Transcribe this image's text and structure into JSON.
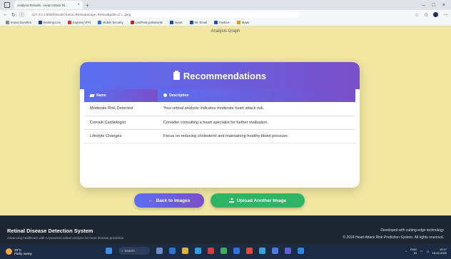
{
  "browser": {
    "tab_title": "Analysis Results - Heart Attack Ri...",
    "url": "127.0.0.1:5000/results?name=Retina&image=Retinal&path=C:\\...jpeg",
    "bookmarks": [
      "Import favorites",
      "Booking.com",
      "Express VPN",
      "Mobile Security",
      "LastPass passwords",
      "News",
      "Mr. Email",
      "Fashion",
      "Maps"
    ]
  },
  "page": {
    "graph_label": "Analysis Graph",
    "card_title": "Recommendations",
    "table": {
      "headers": [
        "Name",
        "Description"
      ],
      "rows": [
        [
          "Moderate Risk Detected",
          "Your retinal analysis indicates moderate heart attack risk."
        ],
        [
          "Consult Cardiologist",
          "Consider consulting a heart specialist for further evaluation."
        ],
        [
          "Lifestyle Changes",
          "Focus on reducing cholesterol and maintaining healthy blood pressure."
        ]
      ]
    },
    "back_button": "Back to Images",
    "upload_button": "Upload Another Image"
  },
  "footer": {
    "title": "Retinal Disease Detection System",
    "subtitle": "Advancing healthcare with AI-powered retinal analysis for heart disease prediction",
    "tagline": "Developed with cutting-edge technology",
    "copyright": "© 2024 Heart Attack Risk Prediction System. All rights reserved."
  },
  "taskbar": {
    "weather_temp": "28°C",
    "weather_desc": "Partly sunny",
    "search_label": "Search",
    "lang": "ENG",
    "lang_sub": "IN",
    "time": "10:17",
    "date": "16-02-2025"
  },
  "colors": {
    "primary_gradient_start": "#5a6ff0",
    "primary_gradient_end": "#7a4fc9",
    "success": "#2fb365",
    "page_bg": "#f1e7a1",
    "footer_bg": "#1d2631"
  }
}
